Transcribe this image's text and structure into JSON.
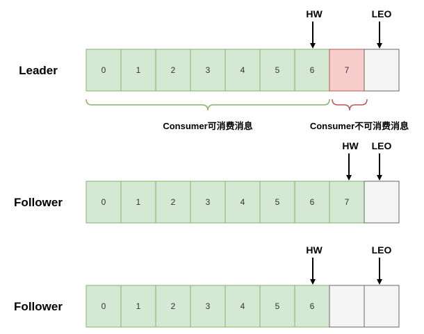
{
  "colors": {
    "committed_fill": "#d5e8d4",
    "committed_stroke": "#82b366",
    "uncommitted_fill": "#f8cecc",
    "uncommitted_stroke": "#b85450",
    "empty_fill": "#f5f5f5",
    "empty_stroke": "#666666",
    "brace_consumable": "#82b366",
    "brace_unconsumable": "#b85450"
  },
  "rows": [
    {
      "label": "Leader",
      "cells": [
        {
          "text": "0",
          "state": "committed"
        },
        {
          "text": "1",
          "state": "committed"
        },
        {
          "text": "2",
          "state": "committed"
        },
        {
          "text": "3",
          "state": "committed"
        },
        {
          "text": "4",
          "state": "committed"
        },
        {
          "text": "5",
          "state": "committed"
        },
        {
          "text": "6",
          "state": "committed"
        },
        {
          "text": "7",
          "state": "uncommitted"
        },
        {
          "text": "",
          "state": "empty"
        }
      ],
      "markers": [
        {
          "label": "HW",
          "cell": 7
        },
        {
          "label": "LEO",
          "cell": 8
        }
      ],
      "braces": [
        {
          "label": "Consumer可消费消息",
          "from": 0,
          "to": 7,
          "kind": "consumable"
        },
        {
          "label": "Consumer不可消费消息",
          "from": 7,
          "to": 8,
          "kind": "unconsumable"
        }
      ]
    },
    {
      "label": "Follower",
      "cells": [
        {
          "text": "0",
          "state": "committed"
        },
        {
          "text": "1",
          "state": "committed"
        },
        {
          "text": "2",
          "state": "committed"
        },
        {
          "text": "3",
          "state": "committed"
        },
        {
          "text": "4",
          "state": "committed"
        },
        {
          "text": "5",
          "state": "committed"
        },
        {
          "text": "6",
          "state": "committed"
        },
        {
          "text": "7",
          "state": "committed"
        },
        {
          "text": "",
          "state": "empty"
        }
      ],
      "markers": [
        {
          "label": "HW",
          "cell": 8
        },
        {
          "label": "LEO",
          "cell": 8
        }
      ],
      "braces": []
    },
    {
      "label": "Follower",
      "cells": [
        {
          "text": "0",
          "state": "committed"
        },
        {
          "text": "1",
          "state": "committed"
        },
        {
          "text": "2",
          "state": "committed"
        },
        {
          "text": "3",
          "state": "committed"
        },
        {
          "text": "4",
          "state": "committed"
        },
        {
          "text": "5",
          "state": "committed"
        },
        {
          "text": "6",
          "state": "committed"
        },
        {
          "text": "",
          "state": "empty"
        },
        {
          "text": "",
          "state": "empty"
        }
      ],
      "markers": [
        {
          "label": "HW",
          "cell": 7
        },
        {
          "label": "LEO",
          "cell": 8
        }
      ],
      "braces": []
    }
  ]
}
